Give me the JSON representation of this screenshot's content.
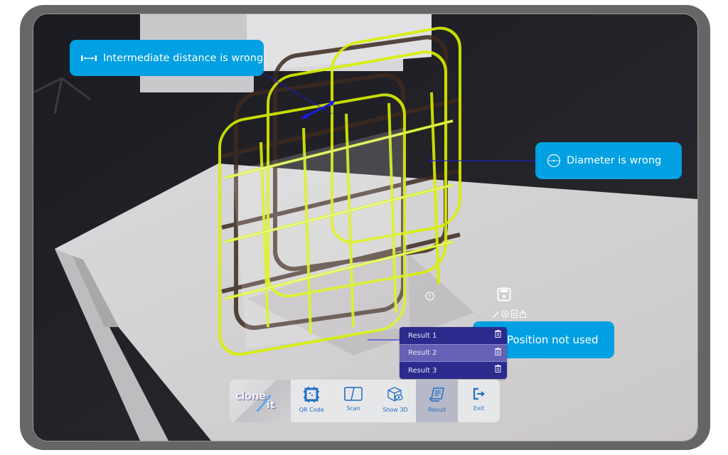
{
  "app": {
    "name": "clone it",
    "logo_text_1": "clone",
    "logo_text_2": "it"
  },
  "annotations": [
    {
      "label": "Intermediate distance is wrong",
      "icon": "distance-icon"
    },
    {
      "label": "Diameter is wrong",
      "icon": "diameter-icon"
    },
    {
      "label": "Position not used",
      "icon": "position-icon"
    }
  ],
  "results_menu": {
    "items": [
      {
        "label": "Result 1",
        "selected": false,
        "icon": "trash-icon"
      },
      {
        "label": "Result 2",
        "selected": true,
        "icon": "trash-icon"
      },
      {
        "label": "Result 3",
        "selected": false,
        "icon": "trash-icon"
      }
    ]
  },
  "floating_tools": {
    "info_icon": "alert-circle-icon",
    "save_icon": "save-icon",
    "small_actions": [
      "pencil-icon",
      "add-circle-icon",
      "document-icon",
      "share-icon"
    ]
  },
  "toolbar": {
    "items": [
      {
        "label": "QR Code",
        "icon": "qr-code-icon",
        "active": false
      },
      {
        "label": "Scan",
        "icon": "scan-icon",
        "active": false
      },
      {
        "label": "Show 3D",
        "icon": "show-3d-icon",
        "active": false
      },
      {
        "label": "Result",
        "icon": "result-icon",
        "active": true
      },
      {
        "label": "Exit",
        "icon": "exit-icon",
        "active": false
      }
    ]
  },
  "colors": {
    "callout": "#00a0e2",
    "menu": "#2d2a8e",
    "menu_selected": "#6561b4",
    "toolbar_icon": "#1f6fc4",
    "overlay": "#d8f000"
  }
}
